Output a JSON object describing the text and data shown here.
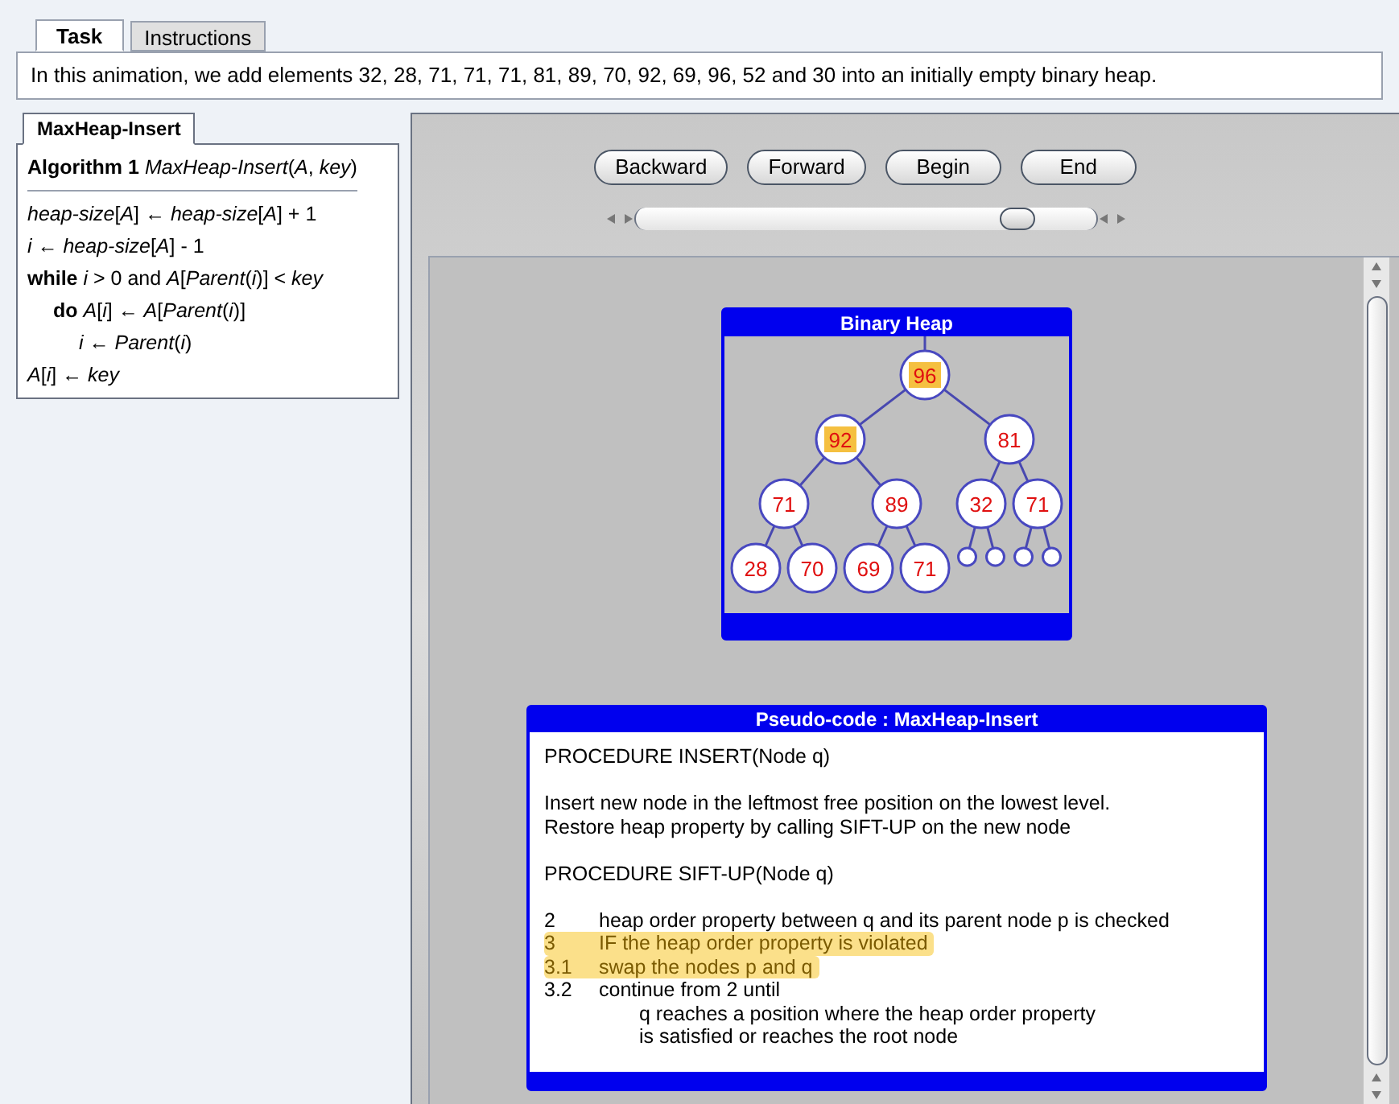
{
  "tabs": [
    {
      "label": "Task",
      "selected": true
    },
    {
      "label": "Instructions",
      "selected": false
    }
  ],
  "task_text": "In this animation, we add elements 32, 28, 71, 71, 71, 81, 89, 70, 92, 69, 96, 52 and 30 into an initially empty binary heap.",
  "algorithm_panel": {
    "tabs": [
      {
        "label": "MaxHeap-Insert",
        "selected": true
      }
    ],
    "heading": "**Algorithm 1** *MaxHeap-Insert*(*A*, *key*)",
    "lines": [
      {
        "text": "*heap-size*[*A*] ← *heap-size*[*A*] + 1"
      },
      {
        "text": "*i* ← *heap-size*[*A*] - 1"
      },
      {
        "text": "**while** *i* > 0 and *A*[*Parent*(*i*)] < *key*",
        "children": [
          {
            "text": "**do** *A*[*i*] ← *A*[*Parent*(*i*)]",
            "children": [
              {
                "text": "*i* ← *Parent*(*i*)"
              }
            ]
          }
        ]
      },
      {
        "text": "*A*[*i*] ← *key*"
      }
    ]
  },
  "controls": {
    "buttons": [
      "Backward",
      "Forward",
      "Begin",
      "End"
    ],
    "slider": {
      "level": 0.83
    }
  },
  "heap": {
    "title": "Binary Heap",
    "root": {
      "kind": "node",
      "value": "96",
      "highlighted": true,
      "children": [
        {
          "kind": "node",
          "value": "92",
          "highlighted": true,
          "children": [
            {
              "kind": "node",
              "value": "71",
              "highlighted": false,
              "children": [
                {
                  "kind": "node",
                  "value": "28",
                  "highlighted": false
                },
                {
                  "kind": "node",
                  "value": "70",
                  "highlighted": false
                }
              ]
            },
            {
              "kind": "node",
              "value": "89",
              "highlighted": false,
              "children": [
                {
                  "kind": "node",
                  "value": "69",
                  "highlighted": false
                },
                {
                  "kind": "node",
                  "value": "71",
                  "highlighted": false
                }
              ]
            }
          ]
        },
        {
          "kind": "node",
          "value": "81",
          "highlighted": false,
          "children": [
            {
              "kind": "node",
              "value": "32",
              "highlighted": false,
              "children": [
                {
                  "kind": "empty"
                },
                {
                  "kind": "empty"
                }
              ]
            },
            {
              "kind": "node",
              "value": "71",
              "highlighted": false,
              "children": [
                {
                  "kind": "empty"
                },
                {
                  "kind": "empty"
                }
              ]
            }
          ]
        }
      ]
    }
  },
  "pseudo_code": {
    "title": "Pseudo-code : MaxHeap-Insert",
    "blocks": [
      {
        "lines": [
          "PROCEDURE INSERT(Node q)"
        ]
      },
      {
        "lines": [
          "Insert new node in the leftmost free position on the lowest level.",
          "Restore heap property by calling SIFT-UP on the new node"
        ]
      },
      {
        "lines": [
          "PROCEDURE SIFT-UP(Node q)"
        ]
      }
    ],
    "steps": [
      {
        "number": "2",
        "text": "heap order property between q and its parent node p is checked",
        "highlighted": false
      },
      {
        "number": "3",
        "text": "IF the heap order property is violated",
        "highlighted": true
      },
      {
        "number": "3.1",
        "text": "swap the nodes p and q",
        "highlighted": true
      },
      {
        "number": "3.2",
        "text": "continue from 2 until",
        "highlighted": false,
        "continuation": [
          "q reaches a position where the heap order property",
          "is satisfied or reaches the root node"
        ]
      }
    ]
  }
}
